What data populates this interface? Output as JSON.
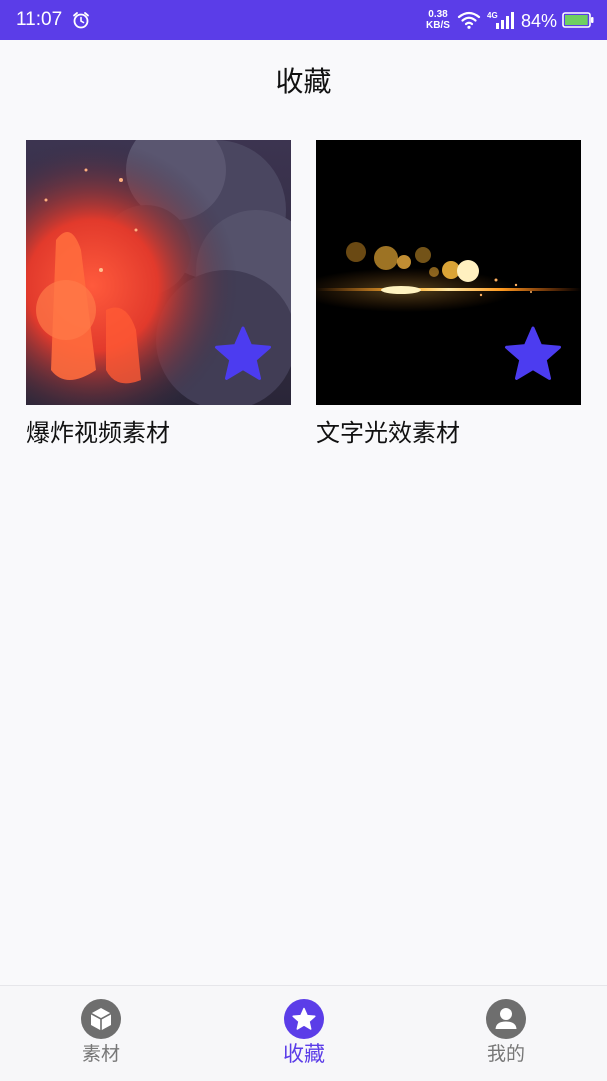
{
  "status_bar": {
    "time": "11:07",
    "net_speed_value": "0.38",
    "net_speed_unit": "KB/S",
    "network_type": "4G",
    "battery": "84%",
    "battery_level": 0.84,
    "background_color": "#5b3de8",
    "icons": [
      "alarm-icon",
      "wifi-icon",
      "signal-icon",
      "battery-icon"
    ]
  },
  "header": {
    "title": "收藏"
  },
  "favorites": [
    {
      "title": "爆炸视频素材",
      "favorited": true,
      "thumbnail_icon": "volcano-explosion-thumbnail"
    },
    {
      "title": "文字光效素材",
      "favorited": true,
      "thumbnail_icon": "light-flare-thumbnail"
    }
  ],
  "accent_color": "#4c3cf0",
  "bottom_nav": {
    "items": [
      {
        "label": "素材",
        "icon": "cube-icon",
        "active": false
      },
      {
        "label": "收藏",
        "icon": "star-icon",
        "active": true
      },
      {
        "label": "我的",
        "icon": "person-icon",
        "active": false
      }
    ]
  }
}
